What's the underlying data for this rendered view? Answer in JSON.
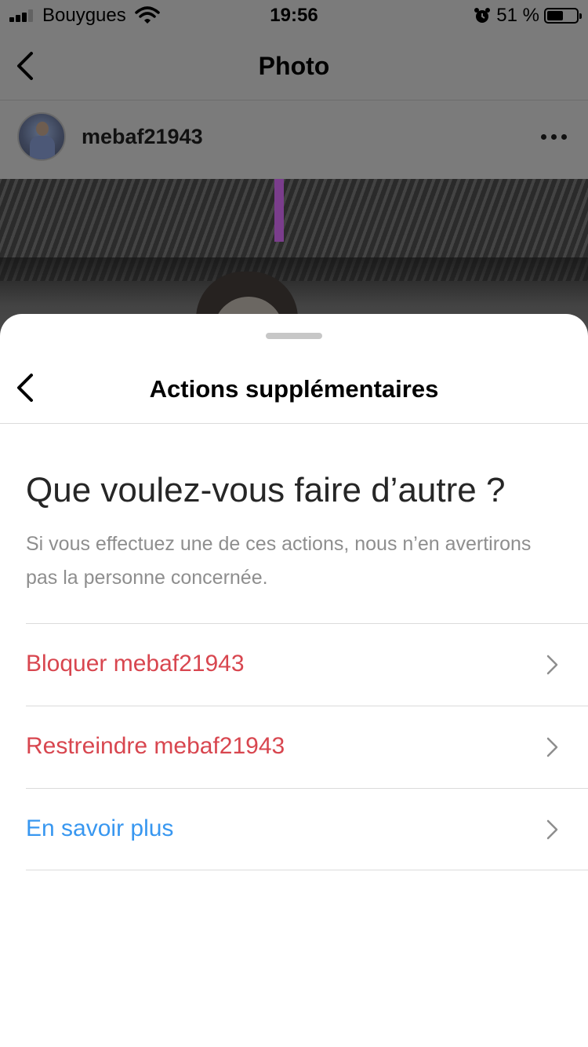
{
  "status_bar": {
    "carrier": "Bouygues",
    "time": "19:56",
    "battery_percent": "51 %"
  },
  "nav": {
    "title": "Photo"
  },
  "post": {
    "username": "mebaf21943"
  },
  "sheet": {
    "title": "Actions supplémentaires",
    "heading": "Que voulez-vous faire d’autre ?",
    "description": "Si vous effectuez une de ces actions, nous n’en avertirons pas la personne concernée.",
    "options": [
      {
        "label": "Bloquer mebaf21943",
        "color": "#d8464f"
      },
      {
        "label": "Restreindre mebaf21943",
        "color": "#d8464f"
      },
      {
        "label": "En savoir plus",
        "color": "#3897f0"
      }
    ]
  },
  "icons": [
    "signal-icon",
    "wifi-icon",
    "alarm-icon",
    "battery-icon",
    "back-icon",
    "more-icon",
    "chevron-right-icon"
  ]
}
